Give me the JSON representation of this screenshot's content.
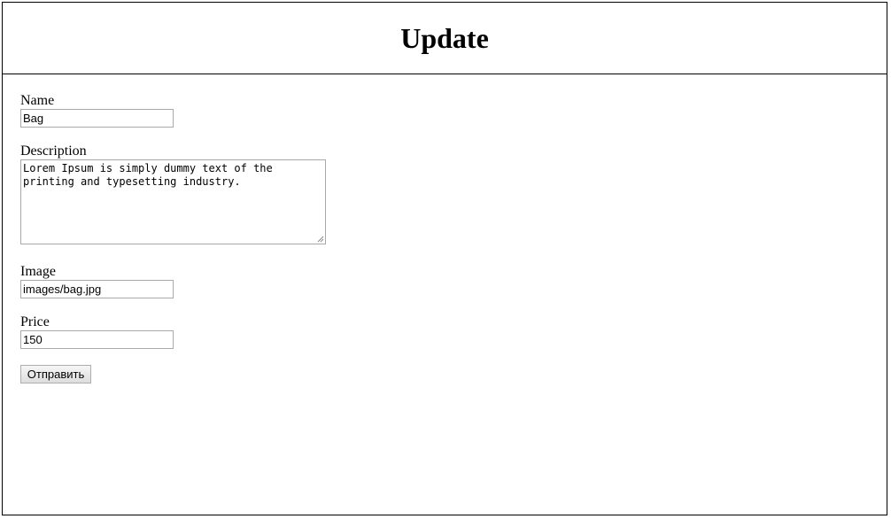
{
  "header": {
    "title": "Update"
  },
  "form": {
    "name": {
      "label": "Name",
      "value": "Bag"
    },
    "description": {
      "label": "Description",
      "value": "Lorem Ipsum is simply dummy text of the printing and typesetting industry."
    },
    "image": {
      "label": "Image",
      "value": "images/bag.jpg"
    },
    "price": {
      "label": "Price",
      "value": "150"
    },
    "submit_label": "Отправить"
  }
}
